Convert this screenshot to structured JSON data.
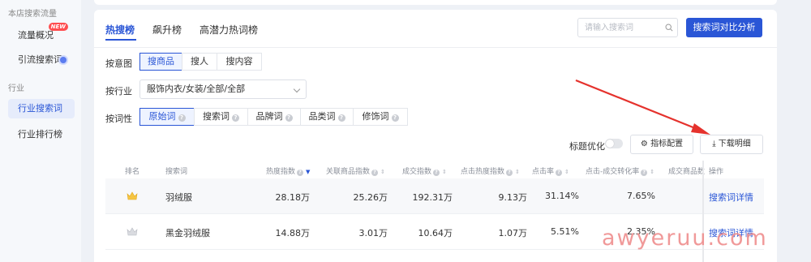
{
  "sidebar": {
    "section1": "本店搜索流量",
    "items1": [
      {
        "label": "流量概况",
        "badge": "NEW"
      },
      {
        "label": "引流搜索词"
      }
    ],
    "section2": "行业",
    "items2": [
      {
        "label": "行业搜索词",
        "active": true
      },
      {
        "label": "行业排行榜"
      }
    ]
  },
  "tabs": [
    {
      "label": "热搜榜",
      "active": true
    },
    {
      "label": "飙升榜"
    },
    {
      "label": "高潜力热词榜"
    }
  ],
  "search": {
    "placeholder": "请输入搜索词"
  },
  "compare_button": "搜索词对比分析",
  "filters": {
    "intent": {
      "label": "按意图",
      "options": [
        "搜商品",
        "搜人",
        "搜内容"
      ],
      "selected": "搜商品"
    },
    "industry": {
      "label": "按行业",
      "value": "服饰内衣/女装/全部/全部"
    },
    "word_type": {
      "label": "按词性",
      "options": [
        "原始词",
        "搜索词",
        "品牌词",
        "品类词",
        "修饰词"
      ],
      "selected": "原始词"
    }
  },
  "toolbar": {
    "title_opt_label": "标题优化",
    "metric_config": "指标配置",
    "download": "下载明细"
  },
  "table": {
    "columns": [
      "排名",
      "搜索词",
      "热度指数",
      "关联商品指数",
      "成交指数",
      "点击热度指数",
      "点击率",
      "点击-成交转化率",
      "成交商品数",
      "操作"
    ],
    "rows": [
      {
        "keyword": "羽绒服",
        "heat": "28.18万",
        "related": "25.26万",
        "deal": "192.31万",
        "click_heat": "9.13万",
        "ctr": "31.14%",
        "cvr": "7.65%",
        "action": "搜索词详情"
      },
      {
        "keyword": "黑金羽绒服",
        "heat": "14.88万",
        "related": "3.01万",
        "deal": "10.64万",
        "click_heat": "1.07万",
        "ctr": "5.51%",
        "cvr": "2.35%",
        "action": "搜索词详情"
      }
    ]
  },
  "watermark": "awyeruu.com",
  "colors": {
    "accent": "#2a56d6",
    "arrow": "#e5322d",
    "gold": "#f5c542",
    "silver": "#c9ccd4"
  }
}
